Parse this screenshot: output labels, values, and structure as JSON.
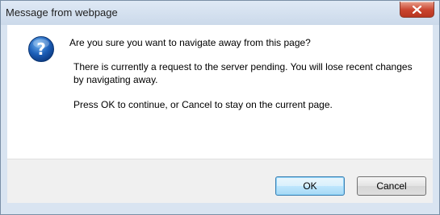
{
  "window": {
    "title": "Message from webpage"
  },
  "dialog": {
    "icon": "question-icon",
    "question": "Are you sure you want to navigate away from this page?",
    "detail": "There is currently a request to the server pending. You will lose recent changes by navigating away.",
    "instruction": "Press OK to continue, or Cancel to stay on the current page."
  },
  "buttons": {
    "ok_label": "OK",
    "cancel_label": "Cancel"
  },
  "colors": {
    "close_button": "#c9442e",
    "icon_blue": "#1c5fb8"
  }
}
